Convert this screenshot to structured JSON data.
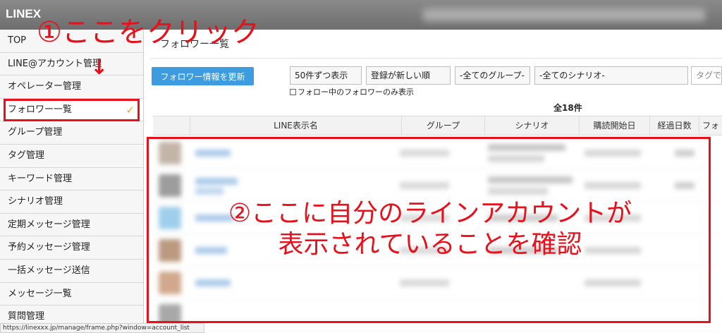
{
  "app": {
    "brand": "LINEX"
  },
  "sidebar": {
    "items": [
      {
        "label": "TOP"
      },
      {
        "label": "LINE@アカウント管理"
      },
      {
        "label": "オペレーター管理"
      },
      {
        "label": "フォロワー一覧",
        "active": true
      },
      {
        "label": "グループ管理"
      },
      {
        "label": "タグ管理"
      },
      {
        "label": "キーワード管理"
      },
      {
        "label": "シナリオ管理"
      },
      {
        "label": "定期メッセージ管理"
      },
      {
        "label": "予約メッセージ管理"
      },
      {
        "label": "一括メッセージ送信"
      },
      {
        "label": "メッセージ一覧"
      },
      {
        "label": "質問管理"
      }
    ],
    "check_mark": "✓"
  },
  "main": {
    "title": "フォロワー一覧",
    "refresh_button": "フォロワー情報を更新",
    "filters": {
      "per_page": "50件ずつ表示",
      "sort": "登録が新しい順",
      "group": "-全てのグループ-",
      "scenario": "-全てのシナリオ-",
      "tag_placeholder": "タグで検"
    },
    "follow_only_label": "フォロー中のフォロワーのみ表示",
    "total": "全18件",
    "table": {
      "headers": [
        "LINE表示名",
        "グループ",
        "シナリオ",
        "購読開始日",
        "経過日数",
        "フォ"
      ]
    }
  },
  "annotations": {
    "step1": "①ここをクリック",
    "step2_line1": "②ここに自分のラインアカウントが",
    "step2_line2": "表示されていることを確認",
    "arrow": "↓"
  },
  "status_bar": "https://linexxx.jp/manage/frame.php?window=account_list",
  "colors": {
    "accent_blue": "#3d9be0",
    "annotation_red": "#e8111b",
    "check_orange": "#f5a623"
  }
}
